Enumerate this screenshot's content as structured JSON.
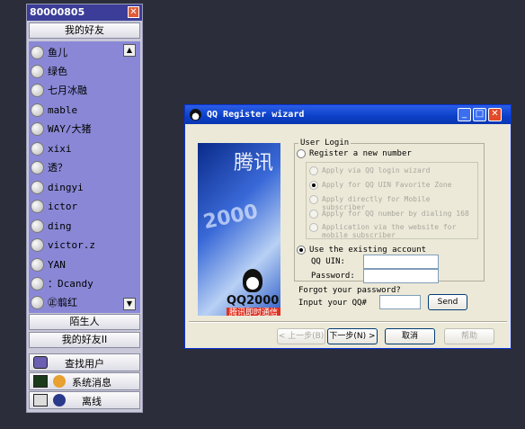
{
  "qq": {
    "title": "80000805",
    "close_glyph": "✕",
    "groups": {
      "friends": "我的好友",
      "strangers": "陌生人",
      "friends2": "我的好友II"
    },
    "buddies": [
      "鱼儿",
      "绿色",
      "七月冰融",
      "mable",
      "WAY/大猪",
      "xixi",
      "透？",
      "dingyi",
      "ictor",
      "ding",
      "victor.z",
      "YAN",
      "：Dcandy",
      "㊣翦红"
    ],
    "tools": {
      "find": "查找用户",
      "sysmsg": "系统消息",
      "offline": "离线"
    },
    "scroll_up": "▲",
    "scroll_down": "▼"
  },
  "wizard": {
    "title": "QQ Register wizard",
    "min": "_",
    "max": "□",
    "close": "✕",
    "banner": {
      "xun": "腾讯",
      "year": "2000",
      "logo": "QQ2000",
      "subtitle": "腾讯即时通信"
    },
    "user_login": "User Login",
    "register_new": "Register a new number",
    "apply_options": [
      "Apply via QQ login wizard",
      "Apply for QQ UIN Favorite Zone",
      "Apply directly for Mobile subscriber",
      "Apply for QQ number by dialing 168",
      "Application via the website for mobile subscriber"
    ],
    "use_existing": "Use the existing account",
    "qq_uin_label": "QQ UIN:",
    "password_label": "Password:",
    "forgot": "Forgot your password?",
    "input_qq": "Input your QQ#",
    "send": "Send",
    "back": "< 上一步(B)",
    "next": "下一步(N) >",
    "cancel": "取消",
    "help": "帮助"
  }
}
